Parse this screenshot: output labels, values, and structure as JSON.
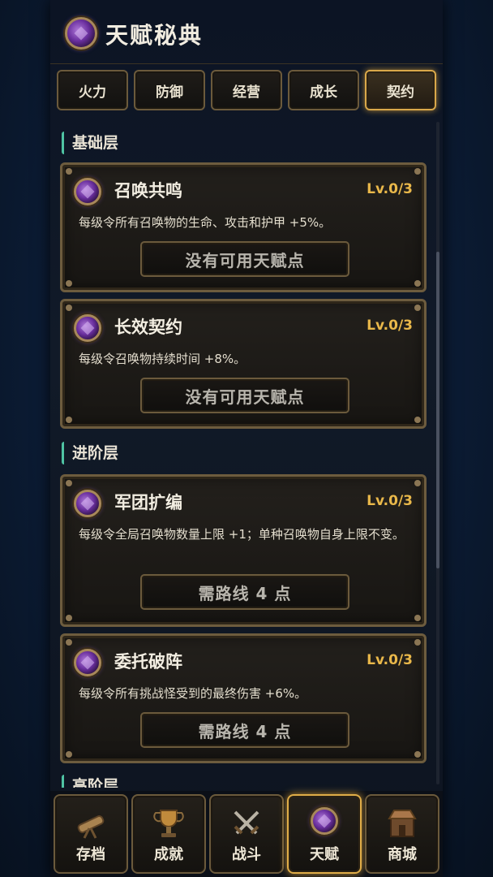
{
  "header": {
    "title": "天赋秘典"
  },
  "tabs": [
    {
      "label": "火力",
      "active": false
    },
    {
      "label": "防御",
      "active": false
    },
    {
      "label": "经营",
      "active": false
    },
    {
      "label": "成长",
      "active": false
    },
    {
      "label": "契约",
      "active": true
    }
  ],
  "sections": {
    "basic": "基础层",
    "advanced": "进阶层",
    "high": "高阶层"
  },
  "talents": [
    {
      "name": "召唤共鸣",
      "level": "Lv.0/3",
      "desc": "每级令所有召唤物的生命、攻击和护甲 +5%。",
      "button": "没有可用天赋点"
    },
    {
      "name": "长效契约",
      "level": "Lv.0/3",
      "desc": "每级令召唤物持续时间 +8%。",
      "button": "没有可用天赋点"
    },
    {
      "name": "军团扩编",
      "level": "Lv.0/3",
      "desc": "每级令全局召唤物数量上限 +1；单种召唤物自身上限不变。",
      "button": "需路线 4 点"
    },
    {
      "name": "委托破阵",
      "level": "Lv.0/3",
      "desc": "每级令所有挑战怪受到的最终伤害 +6%。",
      "button": "需路线 4 点"
    }
  ],
  "nav": [
    {
      "label": "存档",
      "icon": "telescope-icon",
      "active": false
    },
    {
      "label": "成就",
      "icon": "trophy-icon",
      "active": false
    },
    {
      "label": "战斗",
      "icon": "crossed-swords-icon",
      "active": false
    },
    {
      "label": "天赋",
      "icon": "talent-emblem-icon",
      "active": true
    },
    {
      "label": "商城",
      "icon": "shop-icon",
      "active": false
    }
  ],
  "colors": {
    "accent_gold": "#e9b84a",
    "section_marker": "#4fc3a3",
    "emblem_purple": "#6a2f9e"
  }
}
